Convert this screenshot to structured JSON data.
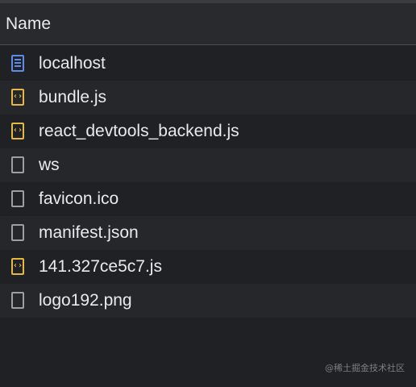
{
  "header": {
    "name_label": "Name"
  },
  "files": [
    {
      "name": "localhost",
      "icon": "document-icon"
    },
    {
      "name": "bundle.js",
      "icon": "script-icon"
    },
    {
      "name": "react_devtools_backend.js",
      "icon": "script-icon"
    },
    {
      "name": "ws",
      "icon": "blank-file-icon"
    },
    {
      "name": "favicon.ico",
      "icon": "blank-file-icon"
    },
    {
      "name": "manifest.json",
      "icon": "blank-file-icon"
    },
    {
      "name": "141.327ce5c7.js",
      "icon": "script-icon"
    },
    {
      "name": "logo192.png",
      "icon": "blank-file-icon"
    }
  ],
  "watermark": "@稀土掘金技术社区",
  "colors": {
    "background": "#202124",
    "document_icon": "#5e8ce8",
    "script_icon": "#e5b743",
    "other_icon": "#9aa0a6"
  }
}
